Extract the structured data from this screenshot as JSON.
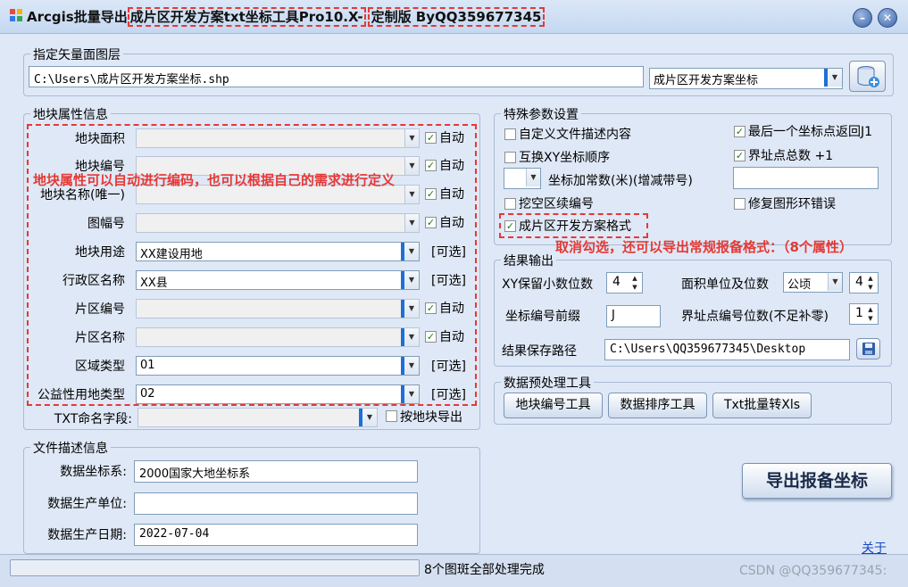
{
  "window": {
    "title_part1": "Arcgis批量导出",
    "title_part2": "成片区开发方案txt坐标工具Pro10.X-",
    "title_part3": "定制版 ByQQ359677345",
    "minimize_glyph": "–",
    "close_glyph": "✕"
  },
  "vector_group": {
    "legend": "指定矢量面图层",
    "path": "C:\\Users\\成片区开发方案坐标.shp",
    "layer": "成片区开发方案坐标"
  },
  "attr_group": {
    "legend": "地块属性信息",
    "rows": [
      {
        "label": "地块面积",
        "value": "",
        "suffix": "自动",
        "checked": true
      },
      {
        "label": "地块编号",
        "value": "",
        "suffix": "自动",
        "checked": true
      },
      {
        "label": "地块名称(唯一)",
        "value": "",
        "suffix": "自动",
        "checked": true
      },
      {
        "label": "图幅号",
        "value": "",
        "suffix": "自动",
        "checked": true
      },
      {
        "label": "地块用途",
        "value": "XX建设用地",
        "suffix": "[可选]",
        "checked": false
      },
      {
        "label": "行政区名称",
        "value": "XX县",
        "suffix": "[可选]",
        "checked": false
      },
      {
        "label": "片区编号",
        "value": "",
        "suffix": "自动",
        "checked": true
      },
      {
        "label": "片区名称",
        "value": "",
        "suffix": "自动",
        "checked": true
      },
      {
        "label": "区域类型",
        "value": "01",
        "suffix": "[可选]",
        "checked": false
      },
      {
        "label": "公益性用地类型",
        "value": "02",
        "suffix": "[可选]",
        "checked": false
      }
    ],
    "txt_name_label": "TXT命名字段:",
    "txt_name_value": "",
    "export_by_parcel": "按地块导出",
    "annotation": "地块属性可以自动进行编码，也可以根据自己的需求进行定义"
  },
  "special_group": {
    "legend": "特殊参数设置",
    "custom_desc": "自定义文件描述内容",
    "swap_xy": "互换XY坐标顺序",
    "const_label": "坐标加常数(米)(增减带号)",
    "const_value": "",
    "hollow_renumber": "挖空区续编号",
    "cpq_format": "成片区开发方案格式",
    "last_point_return": "最后一个坐标点返回J1",
    "boundary_total": "界址点总数 +1",
    "boundary_total_value": "",
    "repair_ring": "修复图形环错误",
    "annotation": "取消勾选，还可以导出常规报备格式：（8个属性）"
  },
  "output_group": {
    "legend": "结果输出",
    "xy_decimals_label": "XY保留小数位数",
    "xy_decimals": "4",
    "area_unit_label": "面积单位及位数",
    "area_unit": "公顷",
    "area_decimals": "4",
    "prefix_label": "坐标编号前缀",
    "prefix": "J",
    "pad_label": "界址点编号位数(不足补零)",
    "pad": "1",
    "save_path_label": "结果保存路径",
    "save_path": "C:\\Users\\QQ359677345\\Desktop"
  },
  "preprocess_group": {
    "legend": "数据预处理工具",
    "btn1": "地块编号工具",
    "btn2": "数据排序工具",
    "btn3": "Txt批量转Xls"
  },
  "desc_group": {
    "legend": "文件描述信息",
    "crs_label": "数据坐标系:",
    "crs": "2000国家大地坐标系",
    "unit_label": "数据生产单位:",
    "unit": "",
    "date_label": "数据生产日期:",
    "date": "2022-07-04"
  },
  "export_button": "导出报备坐标",
  "about_link": "关于",
  "status": {
    "text": "8个图斑全部处理完成",
    "progress": 0,
    "watermark": "CSDN @QQ359677345:"
  },
  "colors": {
    "annotation_red": "#e53935",
    "background": "#dfe8f6"
  }
}
